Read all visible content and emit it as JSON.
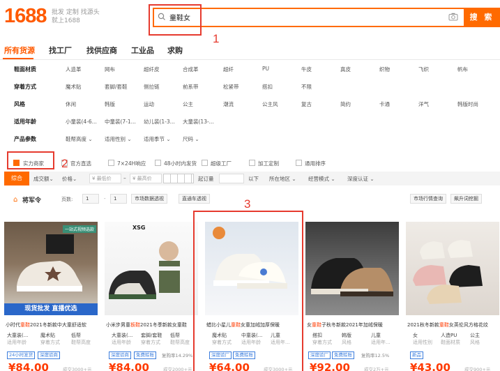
{
  "header": {
    "logo": "1688",
    "slogan_line1": "批发 定制 找源头",
    "slogan_line2": "就上1688",
    "search_query": "童鞋女",
    "search_button": "搜 索"
  },
  "annotations": [
    "1",
    "2",
    "3"
  ],
  "tabs": [
    "所有货源",
    "找工厂",
    "找供应商",
    "工业品",
    "求购"
  ],
  "filters": [
    {
      "label": "鞋面材质",
      "options": [
        "人造革",
        "网布",
        "超纤皮",
        "合成革",
        "超纤",
        "PU",
        "牛皮",
        "真皮",
        "织物",
        "飞织",
        "帆布"
      ]
    },
    {
      "label": "穿着方式",
      "options": [
        "魔术贴",
        "套脚/套鞋",
        "侧拉链",
        "前系带",
        "松紧带",
        "搭扣",
        "不限"
      ]
    },
    {
      "label": "风格",
      "options": [
        "休闲",
        "韩版",
        "运动",
        "公主",
        "潮流",
        "公主风",
        "复古",
        "简约",
        "卡通",
        "洋气",
        "韩版时尚"
      ]
    },
    {
      "label": "适用年龄",
      "options": [
        "小童装(4-6...",
        "中童装(7-1...",
        "幼儿装(1-3...",
        "大童装(13-..."
      ]
    },
    {
      "label": "产品参数",
      "options": [
        "鞋帮高度",
        "适用性别",
        "适用季节",
        "尺码"
      ]
    }
  ],
  "checkbox_options": [
    "实力商家",
    "官方直选",
    "7×24H响应",
    "48小时内发货",
    "超级工厂",
    "加工定制",
    "通用排序"
  ],
  "sortbar": {
    "active": "综合",
    "items": [
      "成交额",
      "价格",
      "¥ 最低价",
      "–",
      "¥ 最高价",
      "起订量",
      "以下",
      "所在地区",
      "经营模式",
      "深度认证"
    ]
  },
  "toolbar": {
    "title": "将军令",
    "page_label": "页数:",
    "page_current": "1",
    "page_total": "1",
    "btn1": "市场数据透视",
    "btn2": "直通车透视",
    "btn3": "市场行情查询",
    "btn4": "飙升词挖掘"
  },
  "products": [
    {
      "title_pre": "小时代",
      "title_hl": "童鞋",
      "title_post": "2021冬新款中大童舒适软",
      "attrs": [
        [
          "大童装(...",
          "适用年龄"
        ],
        [
          "魔术贴",
          "穿着方式"
        ],
        [
          "低帮",
          "鞋帮高度"
        ]
      ],
      "tags": [
        "24小时发货",
        "深度验商"
      ],
      "tag_extra": "",
      "price": "¥84.00",
      "sold": "成交3000+元"
    },
    {
      "title_pre": "小米步男童",
      "title_hl": "板鞋",
      "title_post": "2021冬季新款女童鞋",
      "attrs": [
        [
          "大童装(...",
          "适用年龄"
        ],
        [
          "套脚/套鞋",
          "穿着方式"
        ],
        [
          "低帮",
          "鞋帮高度"
        ]
      ],
      "tags": [
        "深度验商",
        "免费赊账"
      ],
      "tag_extra": "复购率14.29%",
      "price": "¥84.00",
      "sold": "成交2000+元"
    },
    {
      "title_pre": "蜡比小星儿",
      "title_hl": "童鞋",
      "title_post": "女童加绒加厚保暖",
      "attrs": [
        [
          "魔术贴",
          "穿着方式"
        ],
        [
          "中童装(...",
          "适用年龄"
        ],
        [
          "儿童",
          "适用年..."
        ]
      ],
      "tags": [
        "深度验厂",
        "免费赊账"
      ],
      "tag_extra": "",
      "price": "¥64.00",
      "sold": "成交3000+元"
    },
    {
      "title_pre": "女",
      "title_hl": "童鞋",
      "title_post": "子秋冬新款2021年加绒保暖",
      "attrs": [
        [
          "搭扣",
          "穿着方式"
        ],
        [
          "韩版",
          "风格"
        ],
        [
          "儿童",
          "适用年..."
        ]
      ],
      "tags": [
        "深度验厂",
        "免费赊账"
      ],
      "tag_extra": "复购率12.5%",
      "price": "¥92.00",
      "sold": "成交2万+元"
    },
    {
      "title_pre": "2021秋冬新款",
      "title_hl": "童鞋",
      "title_post": "女英伦风方格花纹",
      "attrs": [
        [
          "女",
          "适用性别"
        ],
        [
          "人造PU",
          "鞋面材质"
        ],
        [
          "公主",
          "风格"
        ]
      ],
      "tags": [
        "新品"
      ],
      "tag_extra": "",
      "price": "¥43.00",
      "sold": "成交900+元"
    }
  ],
  "image_captions": [
    "一站式视频选款",
    "现货批发 直播优选",
    "XSG"
  ],
  "colors": {
    "brand": "#ff6a00",
    "annotation": "#e63a2e",
    "price": "#ff3a00",
    "tag": "#3b7ddd"
  }
}
